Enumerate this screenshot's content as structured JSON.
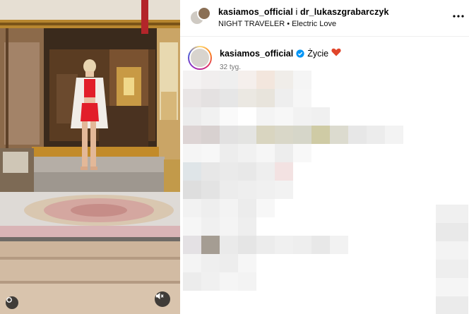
{
  "header": {
    "user_primary": "kasiamos_official",
    "joiner": " i ",
    "user_secondary": "dr_lukaszgrabarczyk",
    "audio_title": "NIGHT TRAVELER • Electric Love"
  },
  "caption": {
    "username": "kasiamos_official",
    "text": "Życie",
    "emoji": "heart-icon",
    "timestamp": "32 tyg."
  },
  "colors": {
    "verified": "#0095f6",
    "heart": "#e0452b",
    "skirt": "#e21e2a",
    "secondary_text": "#737373"
  },
  "icons": [
    "carousel-dot-icon",
    "mute-icon",
    "more-options-icon",
    "verified-badge-icon",
    "heart-icon"
  ]
}
